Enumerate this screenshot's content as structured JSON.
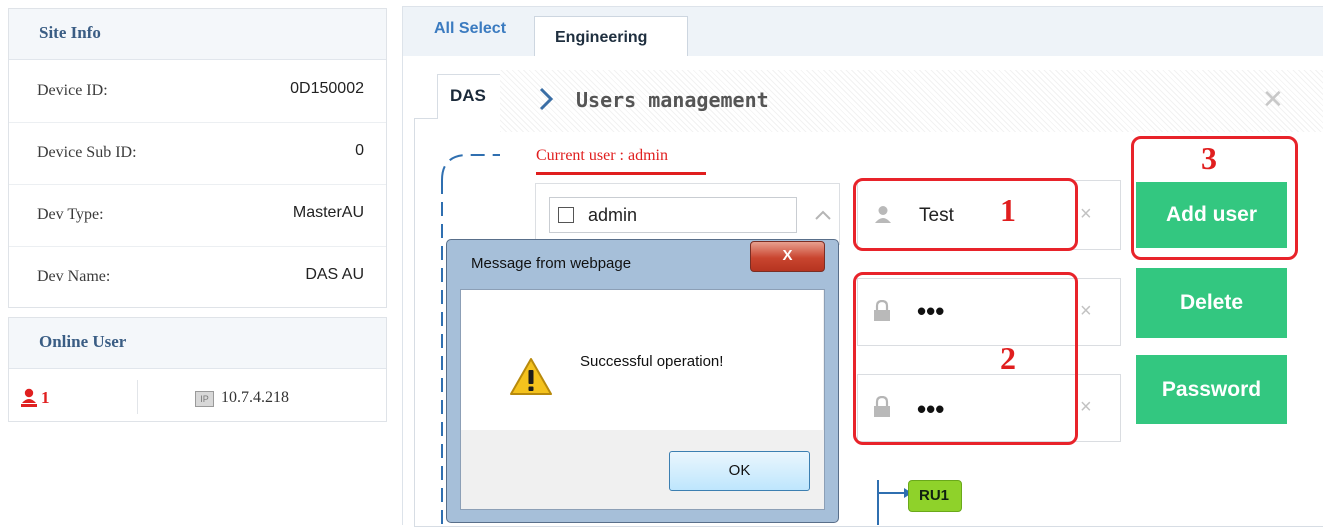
{
  "site_info": {
    "title": "Site Info",
    "rows": [
      {
        "label": "Device ID:",
        "value": "0D150002"
      },
      {
        "label": "Device Sub ID:",
        "value": "0"
      },
      {
        "label": "Dev Type:",
        "value": "MasterAU"
      },
      {
        "label": "Dev Name:",
        "value": "DAS AU"
      }
    ]
  },
  "online_user": {
    "title": "Online User",
    "count": "1",
    "ip_badge": "IP",
    "ip": "10.7.4.218"
  },
  "tabs": {
    "all_select": "All Select",
    "engineering": "Engineering",
    "sub_tab": "DAS"
  },
  "users_management": {
    "title": "Users management",
    "close_glyph": "✕",
    "current_user": "Current user : admin",
    "user_list": [
      {
        "name": "admin",
        "checked": false
      }
    ],
    "username_value": "Test",
    "password_mask": "•••",
    "confirm_mask": "•••",
    "clear_glyph": "×",
    "buttons": {
      "add": "Add user",
      "delete": "Delete",
      "password": "Password"
    },
    "annotations": [
      "1",
      "2",
      "3"
    ]
  },
  "topology": {
    "node": "RU1"
  },
  "message_box": {
    "title": "Message from webpage",
    "close_glyph": "X",
    "text": "Successful operation!",
    "ok": "OK"
  },
  "colors": {
    "green_button": "#33c780",
    "annotation_red": "#e8232a",
    "panel_title": "#3a5d84",
    "tab_link": "#3b7bc0"
  }
}
